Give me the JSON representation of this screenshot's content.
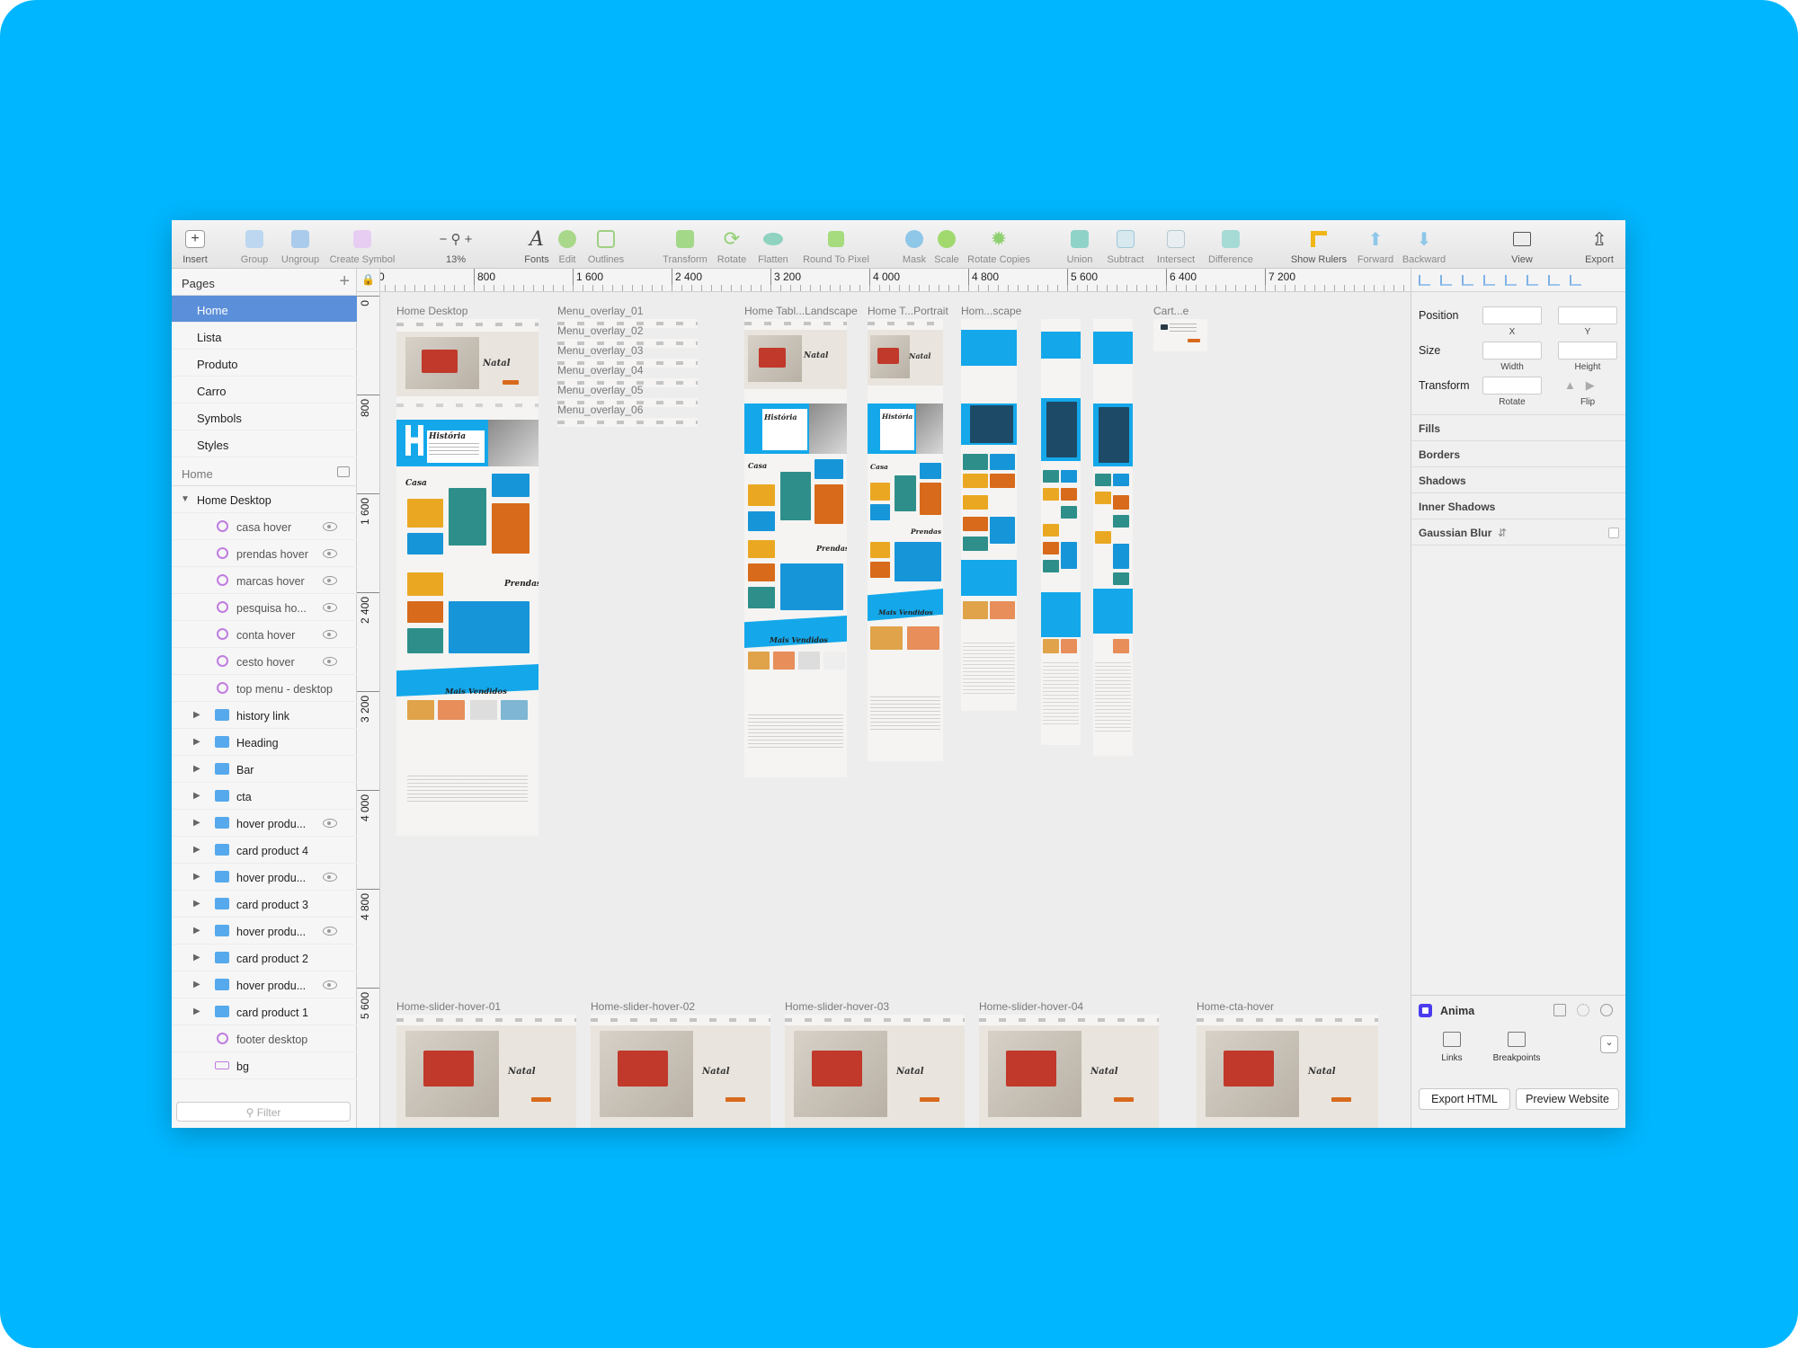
{
  "toolbar": {
    "insert": "Insert",
    "group": "Group",
    "ungroup": "Ungroup",
    "create_symbol": "Create Symbol",
    "zoom": "13%",
    "fonts": "Fonts",
    "edit": "Edit",
    "outlines": "Outlines",
    "transform": "Transform",
    "rotate": "Rotate",
    "flatten": "Flatten",
    "round_to_pixel": "Round To Pixel",
    "mask": "Mask",
    "scale": "Scale",
    "rotate_copies": "Rotate Copies",
    "union": "Union",
    "subtract": "Subtract",
    "intersect": "Intersect",
    "difference": "Difference",
    "show_rulers": "Show Rulers",
    "forward": "Forward",
    "backward": "Backward",
    "view": "View",
    "export": "Export"
  },
  "pages": {
    "header": "Pages",
    "items": [
      "Home",
      "Lista",
      "Produto",
      "Carro",
      "Symbols",
      "Styles"
    ],
    "selected": "Home"
  },
  "layers": {
    "section": "Home",
    "artboard": "Home Desktop",
    "items": [
      {
        "name": "casa hover",
        "type": "symbol"
      },
      {
        "name": "prendas hover",
        "type": "symbol"
      },
      {
        "name": "marcas hover",
        "type": "symbol"
      },
      {
        "name": "pesquisa ho...",
        "type": "symbol"
      },
      {
        "name": "conta hover",
        "type": "symbol"
      },
      {
        "name": "cesto hover",
        "type": "symbol"
      },
      {
        "name": "top menu - desktop",
        "type": "symbol"
      },
      {
        "name": "history link",
        "type": "folder"
      },
      {
        "name": "Heading",
        "type": "folder"
      },
      {
        "name": "Bar",
        "type": "folder"
      },
      {
        "name": "cta",
        "type": "folder"
      },
      {
        "name": "hover produ...",
        "type": "folder"
      },
      {
        "name": "card product 4",
        "type": "folder"
      },
      {
        "name": "hover produ...",
        "type": "folder"
      },
      {
        "name": "card product 3",
        "type": "folder"
      },
      {
        "name": "hover produ...",
        "type": "folder"
      },
      {
        "name": "card product 2",
        "type": "folder"
      },
      {
        "name": "hover produ...",
        "type": "folder"
      },
      {
        "name": "card product 1",
        "type": "folder"
      },
      {
        "name": "footer desktop",
        "type": "symbol"
      },
      {
        "name": "bg",
        "type": "rect"
      }
    ],
    "filter_placeholder": "Filter"
  },
  "ruler": {
    "top": [
      "0",
      "800",
      "1 600",
      "2 400",
      "3 200",
      "4 000",
      "4 800",
      "5 600",
      "6 400",
      "7 200"
    ],
    "left": [
      "0",
      "800",
      "1 600",
      "2 400",
      "3 200",
      "4 000",
      "4 800",
      "5 600"
    ]
  },
  "canvas": {
    "artboards": {
      "home_desktop": "Home Desktop",
      "menu_01": "Menu_overlay_01",
      "menu_02": "Menu_overlay_02",
      "menu_03": "Menu_overlay_03",
      "menu_04": "Menu_overlay_04",
      "menu_05": "Menu_overlay_05",
      "menu_06": "Menu_overlay_06",
      "tablet_landscape": "Home Tabl...Landscape",
      "tablet_portrait": "Home T...Portrait",
      "mobile_landscape": "Hom...scape",
      "cart": "Cart...e",
      "slider_01": "Home-slider-hover-01",
      "slider_02": "Home-slider-hover-02",
      "slider_03": "Home-slider-hover-03",
      "slider_04": "Home-slider-hover-04",
      "cta_hover": "Home-cta-hover"
    },
    "content_words": {
      "natal": "Natal",
      "historia": "História",
      "casa": "Casa",
      "prendas": "Prendas",
      "mais_vendidos": "Mais Vendidos"
    }
  },
  "inspector": {
    "position": "Position",
    "x": "X",
    "y": "Y",
    "size": "Size",
    "width": "Width",
    "height": "Height",
    "transform": "Transform",
    "rotate": "Rotate",
    "flip": "Flip",
    "sections": [
      "Fills",
      "Borders",
      "Shadows",
      "Inner Shadows",
      "Gaussian Blur"
    ]
  },
  "anima": {
    "name": "Anima",
    "links": "Links",
    "breakpoints": "Breakpoints",
    "export_html": "Export HTML",
    "preview_website": "Preview Website"
  },
  "colors": {
    "backdrop": "#00b7ff",
    "selection": "#5b8fd9",
    "accent_blue": "#14a8ea",
    "anima": "#4b3cf0"
  }
}
